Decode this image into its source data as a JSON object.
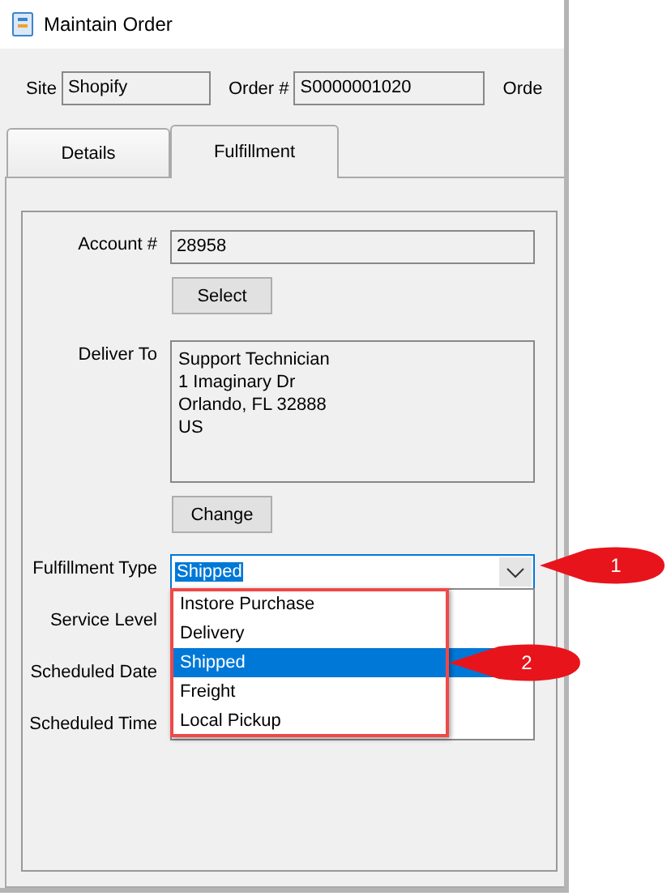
{
  "window": {
    "title": "Maintain Order"
  },
  "header": {
    "fields": [
      {
        "label": "Site",
        "value": "Shopify"
      },
      {
        "label": "Order #",
        "value": "S0000001020"
      }
    ],
    "cut_label": "Orde"
  },
  "tabs": [
    {
      "label": "Details",
      "selected": false
    },
    {
      "label": "Fulfillment",
      "selected": true
    }
  ],
  "account": {
    "label": "Account #",
    "value": "28958",
    "button": "Select"
  },
  "deliver_to": {
    "label": "Deliver To",
    "lines": [
      "Support Technician",
      "1 Imaginary Dr",
      "Orlando, FL  32888",
      "US"
    ],
    "button": "Change"
  },
  "fulfillment_type": {
    "label": "Fulfillment Type",
    "value": "Shipped",
    "expanded": true,
    "options": [
      {
        "label": "Instore Purchase",
        "selected": false
      },
      {
        "label": "Delivery",
        "selected": false
      },
      {
        "label": "Shipped",
        "selected": true
      },
      {
        "label": "Freight",
        "selected": false
      },
      {
        "label": "Local Pickup",
        "selected": false
      }
    ]
  },
  "other_fields": [
    {
      "label": "Service Level"
    },
    {
      "label": "Scheduled Date"
    },
    {
      "label": "Scheduled Time"
    }
  ],
  "callouts": [
    {
      "number": "1"
    },
    {
      "number": "2"
    }
  ]
}
